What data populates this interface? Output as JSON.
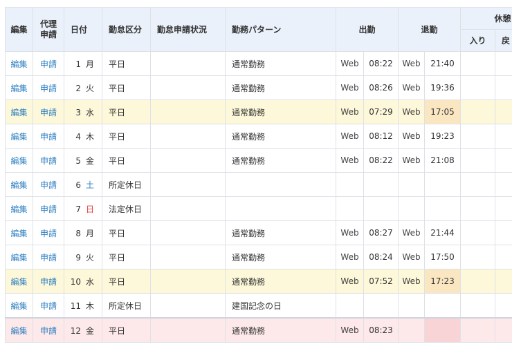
{
  "headers": {
    "edit": "編集",
    "proxy": "代理\n申請",
    "proxy_line1": "代理",
    "proxy_line2": "申請",
    "date": "日付",
    "attendance_type": "勤怠区分",
    "request_status": "勤怠申請状況",
    "work_pattern": "勤務パターン",
    "clock_in": "出勤",
    "clock_out": "退勤",
    "break": "休憩",
    "break_in": "入り",
    "break_return": "戻"
  },
  "rows": [
    {
      "edit": "編集",
      "request": "申請",
      "day": "1",
      "weekday": "月",
      "weekday_type": "normal",
      "type": "平日",
      "status": "",
      "pattern": "通常勤務",
      "in_channel": "Web",
      "in_time": "08:22",
      "out_channel": "Web",
      "out_time": "21:40",
      "style": ""
    },
    {
      "edit": "編集",
      "request": "申請",
      "day": "2",
      "weekday": "火",
      "weekday_type": "normal",
      "type": "平日",
      "status": "",
      "pattern": "通常勤務",
      "in_channel": "Web",
      "in_time": "08:26",
      "out_channel": "Web",
      "out_time": "19:36",
      "style": ""
    },
    {
      "edit": "編集",
      "request": "申請",
      "day": "3",
      "weekday": "水",
      "weekday_type": "normal",
      "type": "平日",
      "status": "",
      "pattern": "通常勤務",
      "in_channel": "Web",
      "in_time": "07:29",
      "out_channel": "Web",
      "out_time": "17:05",
      "style": "yellow"
    },
    {
      "edit": "編集",
      "request": "申請",
      "day": "4",
      "weekday": "木",
      "weekday_type": "normal",
      "type": "平日",
      "status": "",
      "pattern": "通常勤務",
      "in_channel": "Web",
      "in_time": "08:12",
      "out_channel": "Web",
      "out_time": "19:23",
      "style": ""
    },
    {
      "edit": "編集",
      "request": "申請",
      "day": "5",
      "weekday": "金",
      "weekday_type": "normal",
      "type": "平日",
      "status": "",
      "pattern": "通常勤務",
      "in_channel": "Web",
      "in_time": "08:22",
      "out_channel": "Web",
      "out_time": "21:08",
      "style": ""
    },
    {
      "edit": "編集",
      "request": "申請",
      "day": "6",
      "weekday": "土",
      "weekday_type": "sat",
      "type": "所定休日",
      "status": "",
      "pattern": "",
      "in_channel": "",
      "in_time": "",
      "out_channel": "",
      "out_time": "",
      "style": ""
    },
    {
      "edit": "編集",
      "request": "申請",
      "day": "7",
      "weekday": "日",
      "weekday_type": "sun",
      "type": "法定休日",
      "status": "",
      "pattern": "",
      "in_channel": "",
      "in_time": "",
      "out_channel": "",
      "out_time": "",
      "style": ""
    },
    {
      "edit": "編集",
      "request": "申請",
      "day": "8",
      "weekday": "月",
      "weekday_type": "normal",
      "type": "平日",
      "status": "",
      "pattern": "通常勤務",
      "in_channel": "Web",
      "in_time": "08:27",
      "out_channel": "Web",
      "out_time": "21:44",
      "style": ""
    },
    {
      "edit": "編集",
      "request": "申請",
      "day": "9",
      "weekday": "火",
      "weekday_type": "normal",
      "type": "平日",
      "status": "",
      "pattern": "通常勤務",
      "in_channel": "Web",
      "in_time": "08:24",
      "out_channel": "Web",
      "out_time": "17:50",
      "style": ""
    },
    {
      "edit": "編集",
      "request": "申請",
      "day": "10",
      "weekday": "水",
      "weekday_type": "normal",
      "type": "平日",
      "status": "",
      "pattern": "通常勤務",
      "in_channel": "Web",
      "in_time": "07:52",
      "out_channel": "Web",
      "out_time": "17:23",
      "style": "yellow"
    },
    {
      "edit": "編集",
      "request": "申請",
      "day": "11",
      "weekday": "木",
      "weekday_type": "normal",
      "type": "所定休日",
      "status": "",
      "pattern": "建国記念の日",
      "in_channel": "",
      "in_time": "",
      "out_channel": "",
      "out_time": "",
      "style": ""
    },
    {
      "edit": "編集",
      "request": "申請",
      "day": "12",
      "weekday": "金",
      "weekday_type": "normal",
      "type": "平日",
      "status": "",
      "pattern": "通常勤務",
      "in_channel": "Web",
      "in_time": "08:23",
      "out_channel": "",
      "out_time": "",
      "style": "pink"
    }
  ],
  "colors": {
    "link": "#2f7fc1",
    "header_bg": "#eaf1fa",
    "highlight_yellow": "#fcf8d9",
    "highlight_orange": "#fbe6c2",
    "highlight_pink": "#fde9ea",
    "saturday": "#2f7fc1",
    "sunday": "#e2403c"
  }
}
